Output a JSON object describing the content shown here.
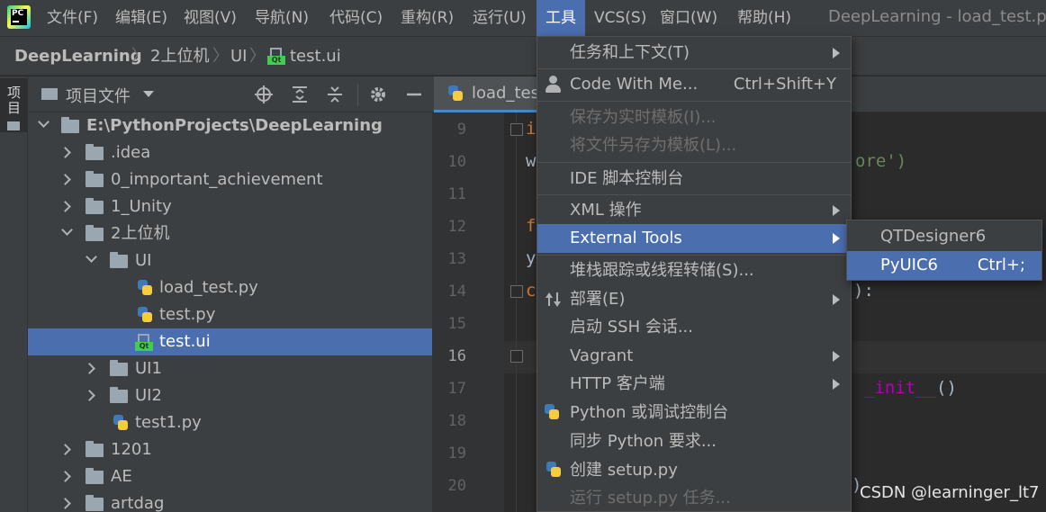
{
  "app": {
    "logo_text": "PC",
    "window_title": "DeepLearning - load_test.py"
  },
  "menubar": {
    "items": [
      "文件(F)",
      "编辑(E)",
      "视图(V)",
      "导航(N)",
      "代码(C)",
      "重构(R)",
      "运行(U)",
      "工具",
      "VCS(S)",
      "窗口(W)",
      "帮助(H)"
    ],
    "active_index": 7
  },
  "breadcrumb": [
    "DeepLearning",
    "2上位机",
    "UI",
    "test.ui"
  ],
  "tool_stripe": {
    "project_label": "项目"
  },
  "project_panel": {
    "title": "项目文件",
    "tree": [
      {
        "label": "E:\\PythonProjects\\DeepLearning",
        "kind": "folder",
        "expanded": true,
        "depth": 0
      },
      {
        "label": ".idea",
        "kind": "folder",
        "expanded": false,
        "depth": 1
      },
      {
        "label": "0_important_achievement",
        "kind": "folder",
        "expanded": false,
        "depth": 1
      },
      {
        "label": "1_Unity",
        "kind": "folder",
        "expanded": false,
        "depth": 1
      },
      {
        "label": "2上位机",
        "kind": "folder",
        "expanded": true,
        "depth": 1
      },
      {
        "label": "UI",
        "kind": "folder",
        "expanded": true,
        "depth": 2
      },
      {
        "label": "load_test.py",
        "kind": "python",
        "depth": 3
      },
      {
        "label": "test.py",
        "kind": "python",
        "depth": 3
      },
      {
        "label": "test.ui",
        "kind": "qt-ui",
        "depth": 3,
        "selected": true
      },
      {
        "label": "UI1",
        "kind": "folder",
        "expanded": false,
        "depth": 2
      },
      {
        "label": "UI2",
        "kind": "folder",
        "expanded": false,
        "depth": 2
      },
      {
        "label": "test1.py",
        "kind": "python",
        "depth": 2
      },
      {
        "label": "1201",
        "kind": "folder",
        "expanded": false,
        "depth": 1
      },
      {
        "label": "AE",
        "kind": "folder",
        "expanded": false,
        "depth": 1
      },
      {
        "label": "artdag",
        "kind": "folder",
        "expanded": false,
        "depth": 1
      }
    ]
  },
  "editor": {
    "tab_label": "load_tes",
    "line_numbers": [
      "9",
      "10",
      "11",
      "12",
      "13",
      "14",
      "15",
      "16",
      "17",
      "18",
      "19",
      "20"
    ],
    "current_line": "16",
    "code_fragments": {
      "l9": "i",
      "l10_a": "w",
      "l10_b": "ore')",
      "l12": "f",
      "l13": "y",
      "l14_a": "c",
      "l14_b": "):",
      "l17": "_init__",
      "l17_b": "()",
      "l20": ")"
    }
  },
  "tools_menu": {
    "items": [
      {
        "label": "任务和上下文(T)",
        "submenu": true
      },
      {
        "separator": true
      },
      {
        "label": "Code With Me...",
        "shortcut": "Ctrl+Shift+Y",
        "icon": "person-icon"
      },
      {
        "separator": true
      },
      {
        "label": "保存为实时模板(I)...",
        "disabled": true
      },
      {
        "label": "将文件另存为模板(L)...",
        "disabled": true
      },
      {
        "separator": true
      },
      {
        "label": "IDE 脚本控制台"
      },
      {
        "separator": true
      },
      {
        "label": "XML 操作",
        "submenu": true
      },
      {
        "label": "External Tools",
        "submenu": true,
        "highlighted": true
      },
      {
        "separator": true
      },
      {
        "label": "堆栈跟踪或线程转储(S)..."
      },
      {
        "label": "部署(E)",
        "submenu": true,
        "icon": "deploy-arrows-icon"
      },
      {
        "label": "启动 SSH 会话..."
      },
      {
        "label": "Vagrant",
        "submenu": true
      },
      {
        "label": "HTTP 客户端",
        "submenu": true
      },
      {
        "label": "Python 或调试控制台",
        "icon": "python-icon"
      },
      {
        "label": "同步 Python 要求..."
      },
      {
        "label": "创建 setup.py",
        "icon": "python-file-icon"
      },
      {
        "label": "运行 setup.py 任务...",
        "disabled": true
      }
    ]
  },
  "external_tools_submenu": {
    "items": [
      {
        "label": "QTDesigner6"
      },
      {
        "label": "PyUIC6",
        "shortcut": "Ctrl+;",
        "highlighted": true
      }
    ]
  },
  "watermark": "CSDN @learninger_lt7",
  "colors": {
    "menubar_bg": "#3c3f41",
    "editor_bg": "#2b2b2b",
    "selection": "#4b6eaf",
    "keyword": "#cc7832",
    "string": "#6a8759"
  }
}
